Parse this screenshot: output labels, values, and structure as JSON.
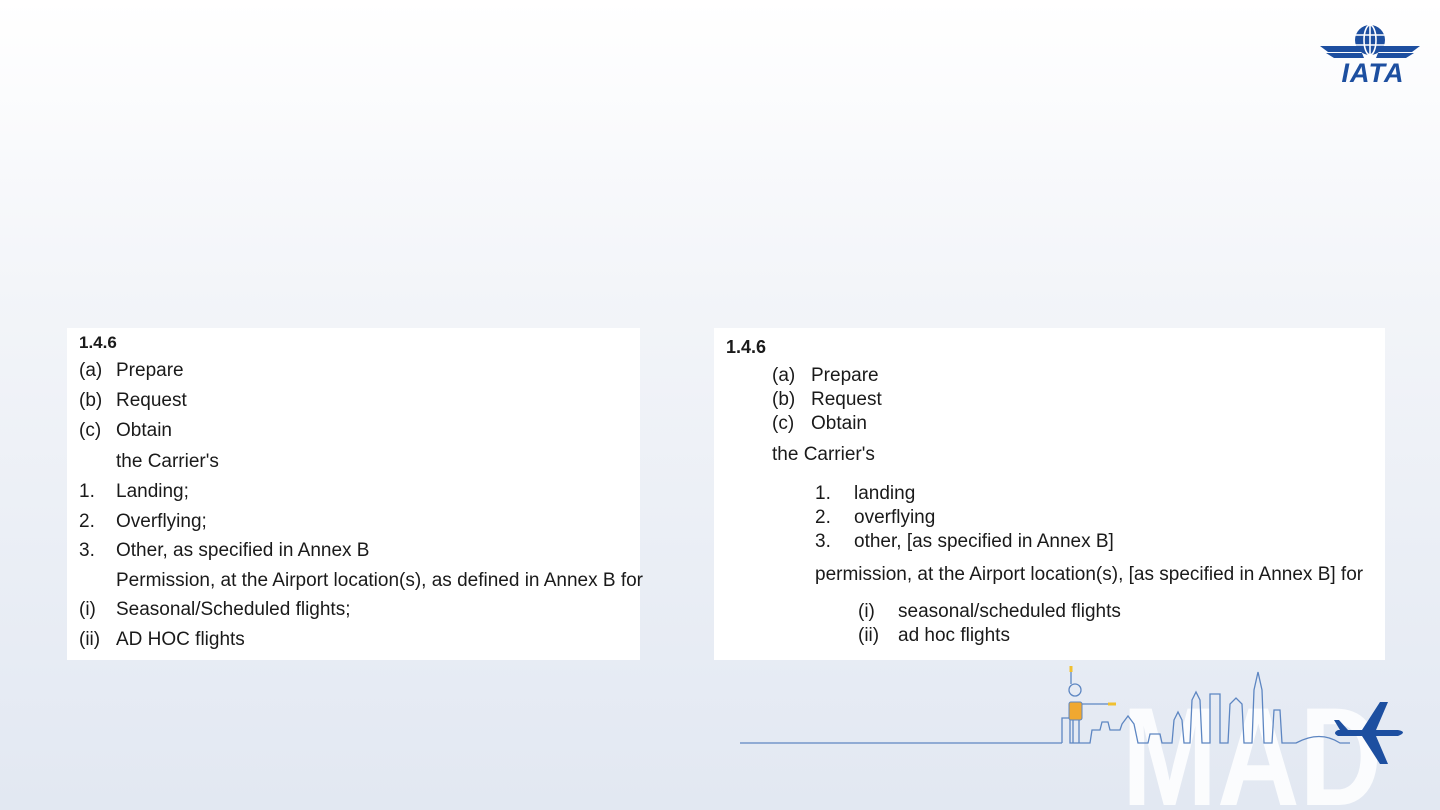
{
  "brand": {
    "logo_text": "IATA",
    "accent": "#1d4fa0",
    "decor_text": "MAD"
  },
  "left_panel": {
    "section": "1.4.6",
    "actions": [
      {
        "marker": "(a)",
        "text": "Prepare"
      },
      {
        "marker": "(b)",
        "text": "Request"
      },
      {
        "marker": "(c)",
        "text": "Obtain"
      }
    ],
    "carrier_line": "the Carrier's",
    "permissions": [
      {
        "marker": "1.",
        "text": "Landing;"
      },
      {
        "marker": "2.",
        "text": "Overflying;"
      },
      {
        "marker": "3.",
        "text": "Other, as specified in Annex B"
      }
    ],
    "permission_line": "Permission, at the Airport location(s), as defined in Annex B for",
    "flights": [
      {
        "marker": "(i)",
        "text": "Seasonal/Scheduled flights;"
      },
      {
        "marker": "(ii)",
        "text": "AD HOC flights"
      }
    ]
  },
  "right_panel": {
    "section": "1.4.6",
    "actions": [
      {
        "marker": "(a)",
        "text": "Prepare"
      },
      {
        "marker": "(b)",
        "text": "Request"
      },
      {
        "marker": "(c)",
        "text": "Obtain"
      }
    ],
    "carrier_line": "the Carrier's",
    "permissions": [
      {
        "marker": "1.",
        "text": "landing"
      },
      {
        "marker": "2.",
        "text": "overflying"
      },
      {
        "marker": "3.",
        "text": "other, [as specified in Annex B]"
      }
    ],
    "permission_line": "permission, at the Airport location(s), [as specified in Annex B] for",
    "flights": [
      {
        "marker": "(i)",
        "text": "seasonal/scheduled flights"
      },
      {
        "marker": "(ii)",
        "text": "ad hoc flights"
      }
    ]
  }
}
